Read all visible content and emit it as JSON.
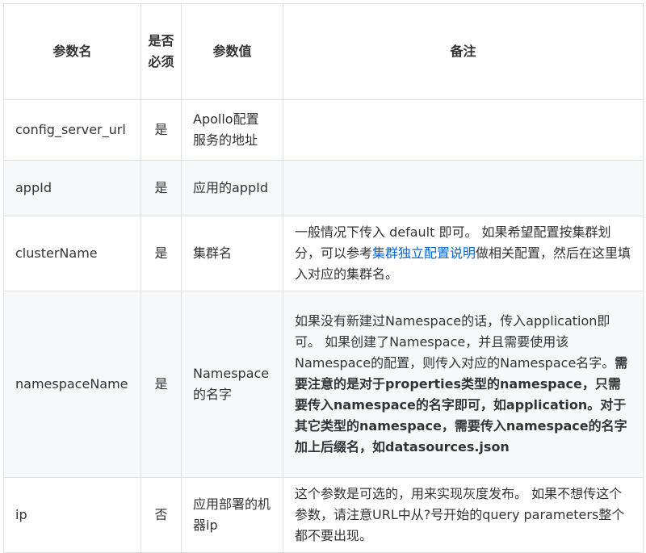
{
  "headers": {
    "name": "参数名",
    "required": "是否必须",
    "value": "参数值",
    "note": "备注"
  },
  "rows": [
    {
      "name": "config_server_url",
      "required": "是",
      "value": "Apollo配置服务的地址",
      "note": {}
    },
    {
      "name": "appId",
      "required": "是",
      "value": "应用的appId",
      "note": {}
    },
    {
      "name": "clusterName",
      "required": "是",
      "value": "集群名",
      "note": {
        "part1": "一般情况下传入 default 即可。 如果希望配置按集群划分，可以参考",
        "link": "集群独立配置说明",
        "part2": "做相关配置，然后在这里填入对应的集群名。"
      }
    },
    {
      "name": "namespaceName",
      "required": "是",
      "value": "Namespace的名字",
      "note": {
        "part1": "如果没有新建过Namespace的话，传入application即可。 如果创建了Namespace，并且需要使用该Namespace的配置，则传入对应的Namespace名字。",
        "bold": "需要注意的是对于properties类型的namespace，只需要传入namespace的名字即可，如application。对于其它类型的namespace，需要传入namespace的名字加上后缀名，如datasources.json"
      }
    },
    {
      "name": "ip",
      "required": "否",
      "value": "应用部署的机器ip",
      "note": {
        "part1": "这个参数是可选的，用来实现灰度发布。 如果不想传这个参数，请注意URL中从?号开始的query parameters整个都不要出现。"
      }
    }
  ]
}
